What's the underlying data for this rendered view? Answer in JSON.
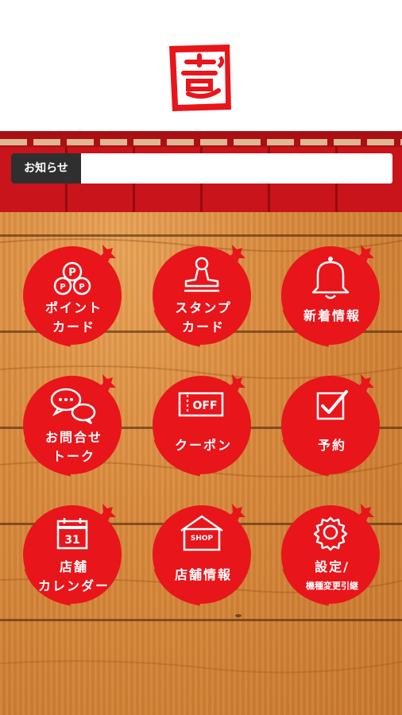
{
  "logo": {
    "glyph": "壱"
  },
  "news": {
    "label": "お知らせ",
    "text": ""
  },
  "menu": [
    {
      "id": "point-card",
      "line1": "ポイント",
      "line2": "カード",
      "icon": "point-card-icon"
    },
    {
      "id": "stamp-card",
      "line1": "スタンプ",
      "line2": "カード",
      "icon": "stamp-icon"
    },
    {
      "id": "news-info",
      "line1": "新着情報",
      "line2": "",
      "icon": "bell-icon"
    },
    {
      "id": "contact-talk",
      "line1": "お問合せ",
      "line2": "トーク",
      "icon": "chat-bubbles-icon"
    },
    {
      "id": "coupon",
      "line1": "クーポン",
      "line2": "",
      "icon": "coupon-off-icon",
      "badge": "OFF"
    },
    {
      "id": "reservation",
      "line1": "予約",
      "line2": "",
      "icon": "checkbox-icon"
    },
    {
      "id": "store-calendar",
      "line1": "店舗",
      "line2": "カレンダー",
      "icon": "calendar-icon",
      "badge": "31"
    },
    {
      "id": "store-info",
      "line1": "店舗情報",
      "line2": "",
      "icon": "shop-icon",
      "badge": "SHOP"
    },
    {
      "id": "settings",
      "line1": "設定/",
      "line2": "機種変更引継",
      "icon": "gear-icon"
    }
  ],
  "colors": {
    "brand_red": "#e8151b",
    "noren_red": "#c8141a",
    "wood": "#d98a3c"
  }
}
